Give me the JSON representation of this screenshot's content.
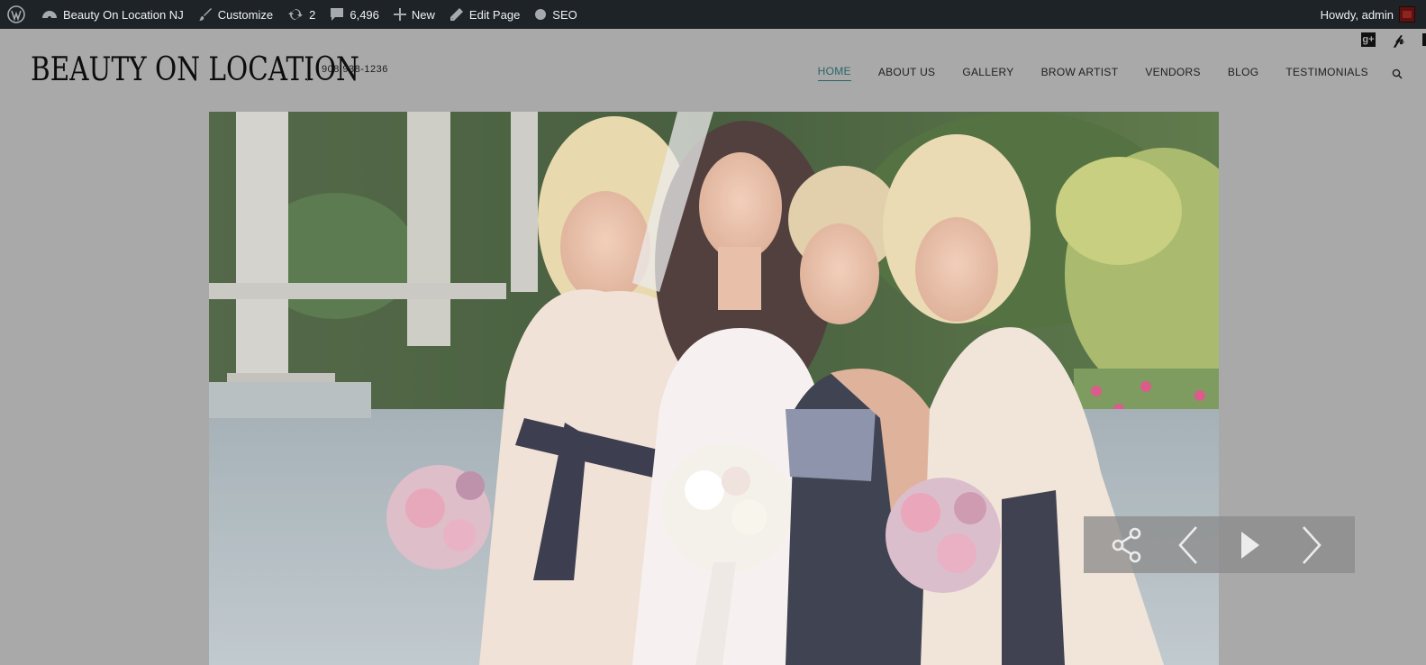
{
  "adminbar": {
    "site_name": "Beauty On Location NJ",
    "customize": "Customize",
    "updates_count": "2",
    "comments_count": "6,496",
    "new_label": "New",
    "edit_page": "Edit Page",
    "seo": "SEO",
    "greeting": "Howdy, admin"
  },
  "header": {
    "logo_text": "BEAUTY ON LOCATION",
    "phone": "908 938-1236",
    "nav": [
      {
        "label": "HOME",
        "active": true
      },
      {
        "label": "ABOUT US"
      },
      {
        "label": "GALLERY"
      },
      {
        "label": "BROW ARTIST"
      },
      {
        "label": "VENDORS"
      },
      {
        "label": "BLOG"
      },
      {
        "label": "TESTIMONIALS"
      }
    ],
    "social_icons": [
      "google-plus-icon",
      "pinterest-icon"
    ]
  },
  "slider": {
    "controls": [
      "share-icon",
      "previous-arrow-icon",
      "play-icon",
      "next-arrow-icon"
    ]
  },
  "colors": {
    "admin_bar": "#1d2327",
    "overlay_gray": "#a9a9a9",
    "active_nav": "#2a6666"
  }
}
